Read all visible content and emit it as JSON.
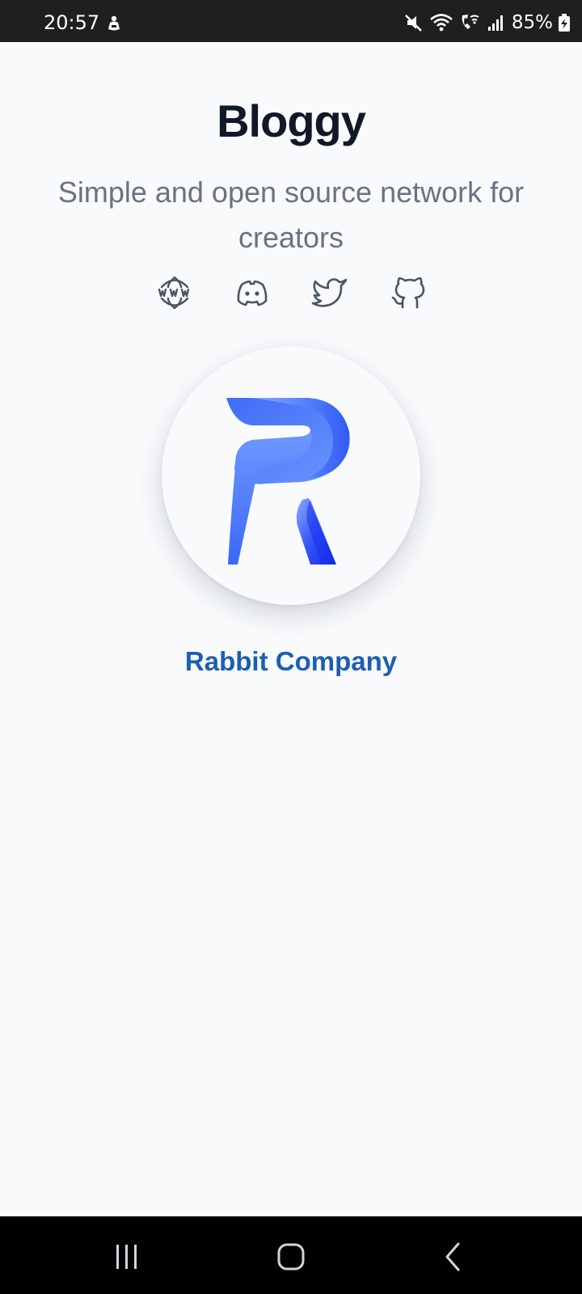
{
  "status_bar": {
    "time": "20:57",
    "battery": "85%"
  },
  "app": {
    "title": "Bloggy",
    "subtitle": "Simple and open source network for creators"
  },
  "social_links": [
    {
      "name": "website",
      "icon": "www-globe-icon"
    },
    {
      "name": "discord",
      "icon": "discord-icon"
    },
    {
      "name": "twitter",
      "icon": "twitter-icon"
    },
    {
      "name": "github",
      "icon": "github-icon"
    }
  ],
  "company": {
    "name": "Rabbit Company",
    "logo_icon": "rabbit-company-r-logo",
    "link_color": "#1d5fae"
  },
  "colors": {
    "background": "#f8fafc",
    "title": "#111827",
    "subtitle": "#6b7280",
    "logo_blue_light": "#5b8cff",
    "logo_blue_dark": "#1a3cf0"
  },
  "nav_bar": {
    "buttons": [
      "recent-apps",
      "home",
      "back"
    ]
  }
}
